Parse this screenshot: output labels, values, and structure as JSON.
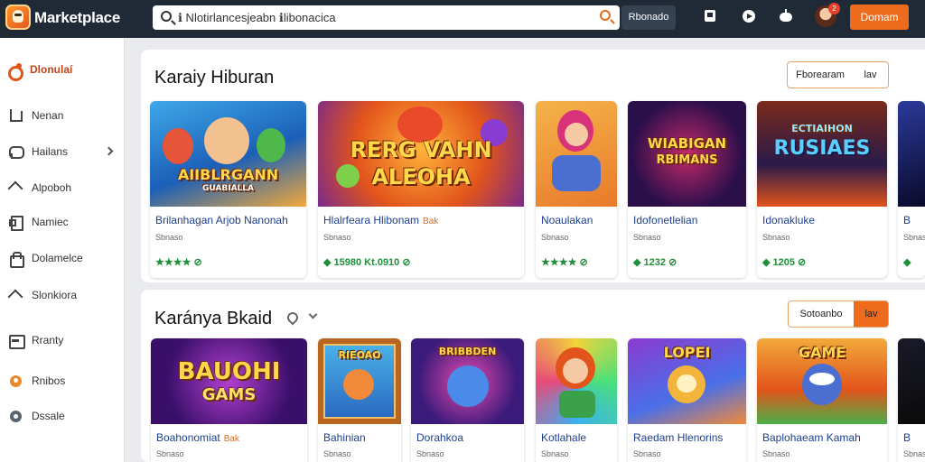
{
  "app": {
    "title": "Marketplace"
  },
  "topbar": {
    "search_value": "ℹ Nlotirlancesjeabn ℹlibonacica",
    "filter_label": "Rbonado",
    "notification_count": "2",
    "signin_label": "Domam"
  },
  "sidebar": {
    "brand_label": "Dlonulaí",
    "items": [
      {
        "label": "Nenan",
        "icon": "home-icon"
      },
      {
        "label": "Hailans",
        "icon": "chat-icon",
        "has_chevron": true
      },
      {
        "label": "Alpoboh",
        "icon": "mountain-icon"
      },
      {
        "label": "Namiec",
        "icon": "door-icon"
      },
      {
        "label": "Dolamelce",
        "icon": "bag-icon"
      },
      {
        "label": "Slonkiora",
        "icon": "tag-icon"
      },
      {
        "label": "Rranty",
        "icon": "calendar-icon"
      },
      {
        "label": "Rnibos",
        "icon": "trophy-icon"
      },
      {
        "label": "Dssale",
        "icon": "gear-icon"
      }
    ]
  },
  "sections": [
    {
      "title": "Karaiy Hiburan",
      "toggle": [
        "Fborearam",
        "lav"
      ],
      "cards": [
        {
          "name": "Brilanhagan Arjob Nanonah",
          "sale": "",
          "meta": "Sbnaso",
          "rating": "★★★★ ⊘",
          "art_text": "AIIBLRGANN",
          "art_sub": "GUABIALLA"
        },
        {
          "name": "Hlalrfeara Hlibonam",
          "sale": "Bak",
          "meta": "Sbnaso",
          "rating": "◆ 15980 Kt.0910 ⊘",
          "art_text": "RERG VAHN",
          "art_sub": "ALEOHA"
        },
        {
          "name": "Noaulakan",
          "sale": "",
          "meta": "Sbnaso",
          "rating": "★★★★ ⊘",
          "art_text": "",
          "art_sub": ""
        },
        {
          "name": "Idofonetlelian",
          "sale": "",
          "meta": "Sbnaso",
          "rating": "◆ 1232 ⊘",
          "art_text": "WIABIGAN",
          "art_sub": "RBIMANS"
        },
        {
          "name": "Idonakluke",
          "sale": "",
          "meta": "Sbnaso",
          "rating": "◆ 1205 ⊘",
          "art_text": "RUSIAES",
          "art_sub": "ECTIAIHON"
        },
        {
          "name": "B",
          "sale": "",
          "meta": "Sbnaso",
          "rating": "◆",
          "art_text": "",
          "art_sub": ""
        }
      ]
    },
    {
      "title": "Karánya Bkaid",
      "toggle": [
        "Sotoanbo",
        "lav"
      ],
      "cards": [
        {
          "name": "Boahonomiat",
          "sale": "Bak",
          "meta": "Sbnaso",
          "art_text": "BAUOHI",
          "art_sub": "GAMS"
        },
        {
          "name": "Bahinian",
          "sale": "",
          "meta": "Sbnaso",
          "art_text": "RIEOAO",
          "art_sub": ""
        },
        {
          "name": "Dorahkoa",
          "sale": "",
          "meta": "Sbnaso",
          "art_text": "BRIBBDEN",
          "art_sub": ""
        },
        {
          "name": "Kotlahale",
          "sale": "",
          "meta": "Sbnaso",
          "art_text": "",
          "art_sub": ""
        },
        {
          "name": "Raedam Hlenorins",
          "sale": "",
          "meta": "Sbnaso",
          "art_text": "LOPEI",
          "art_sub": ""
        },
        {
          "name": "Baplohaeam Kamah",
          "sale": "",
          "meta": "Sbnaso",
          "art_text": "GAME",
          "art_sub": ""
        },
        {
          "name": "B",
          "sale": "",
          "meta": "Sbnaso",
          "art_text": "",
          "art_sub": ""
        }
      ]
    }
  ],
  "colors": {
    "accent": "#ee6a1d",
    "topbar": "#1f2a36",
    "link": "#1d3f8f",
    "rating": "#1f8f3a"
  }
}
